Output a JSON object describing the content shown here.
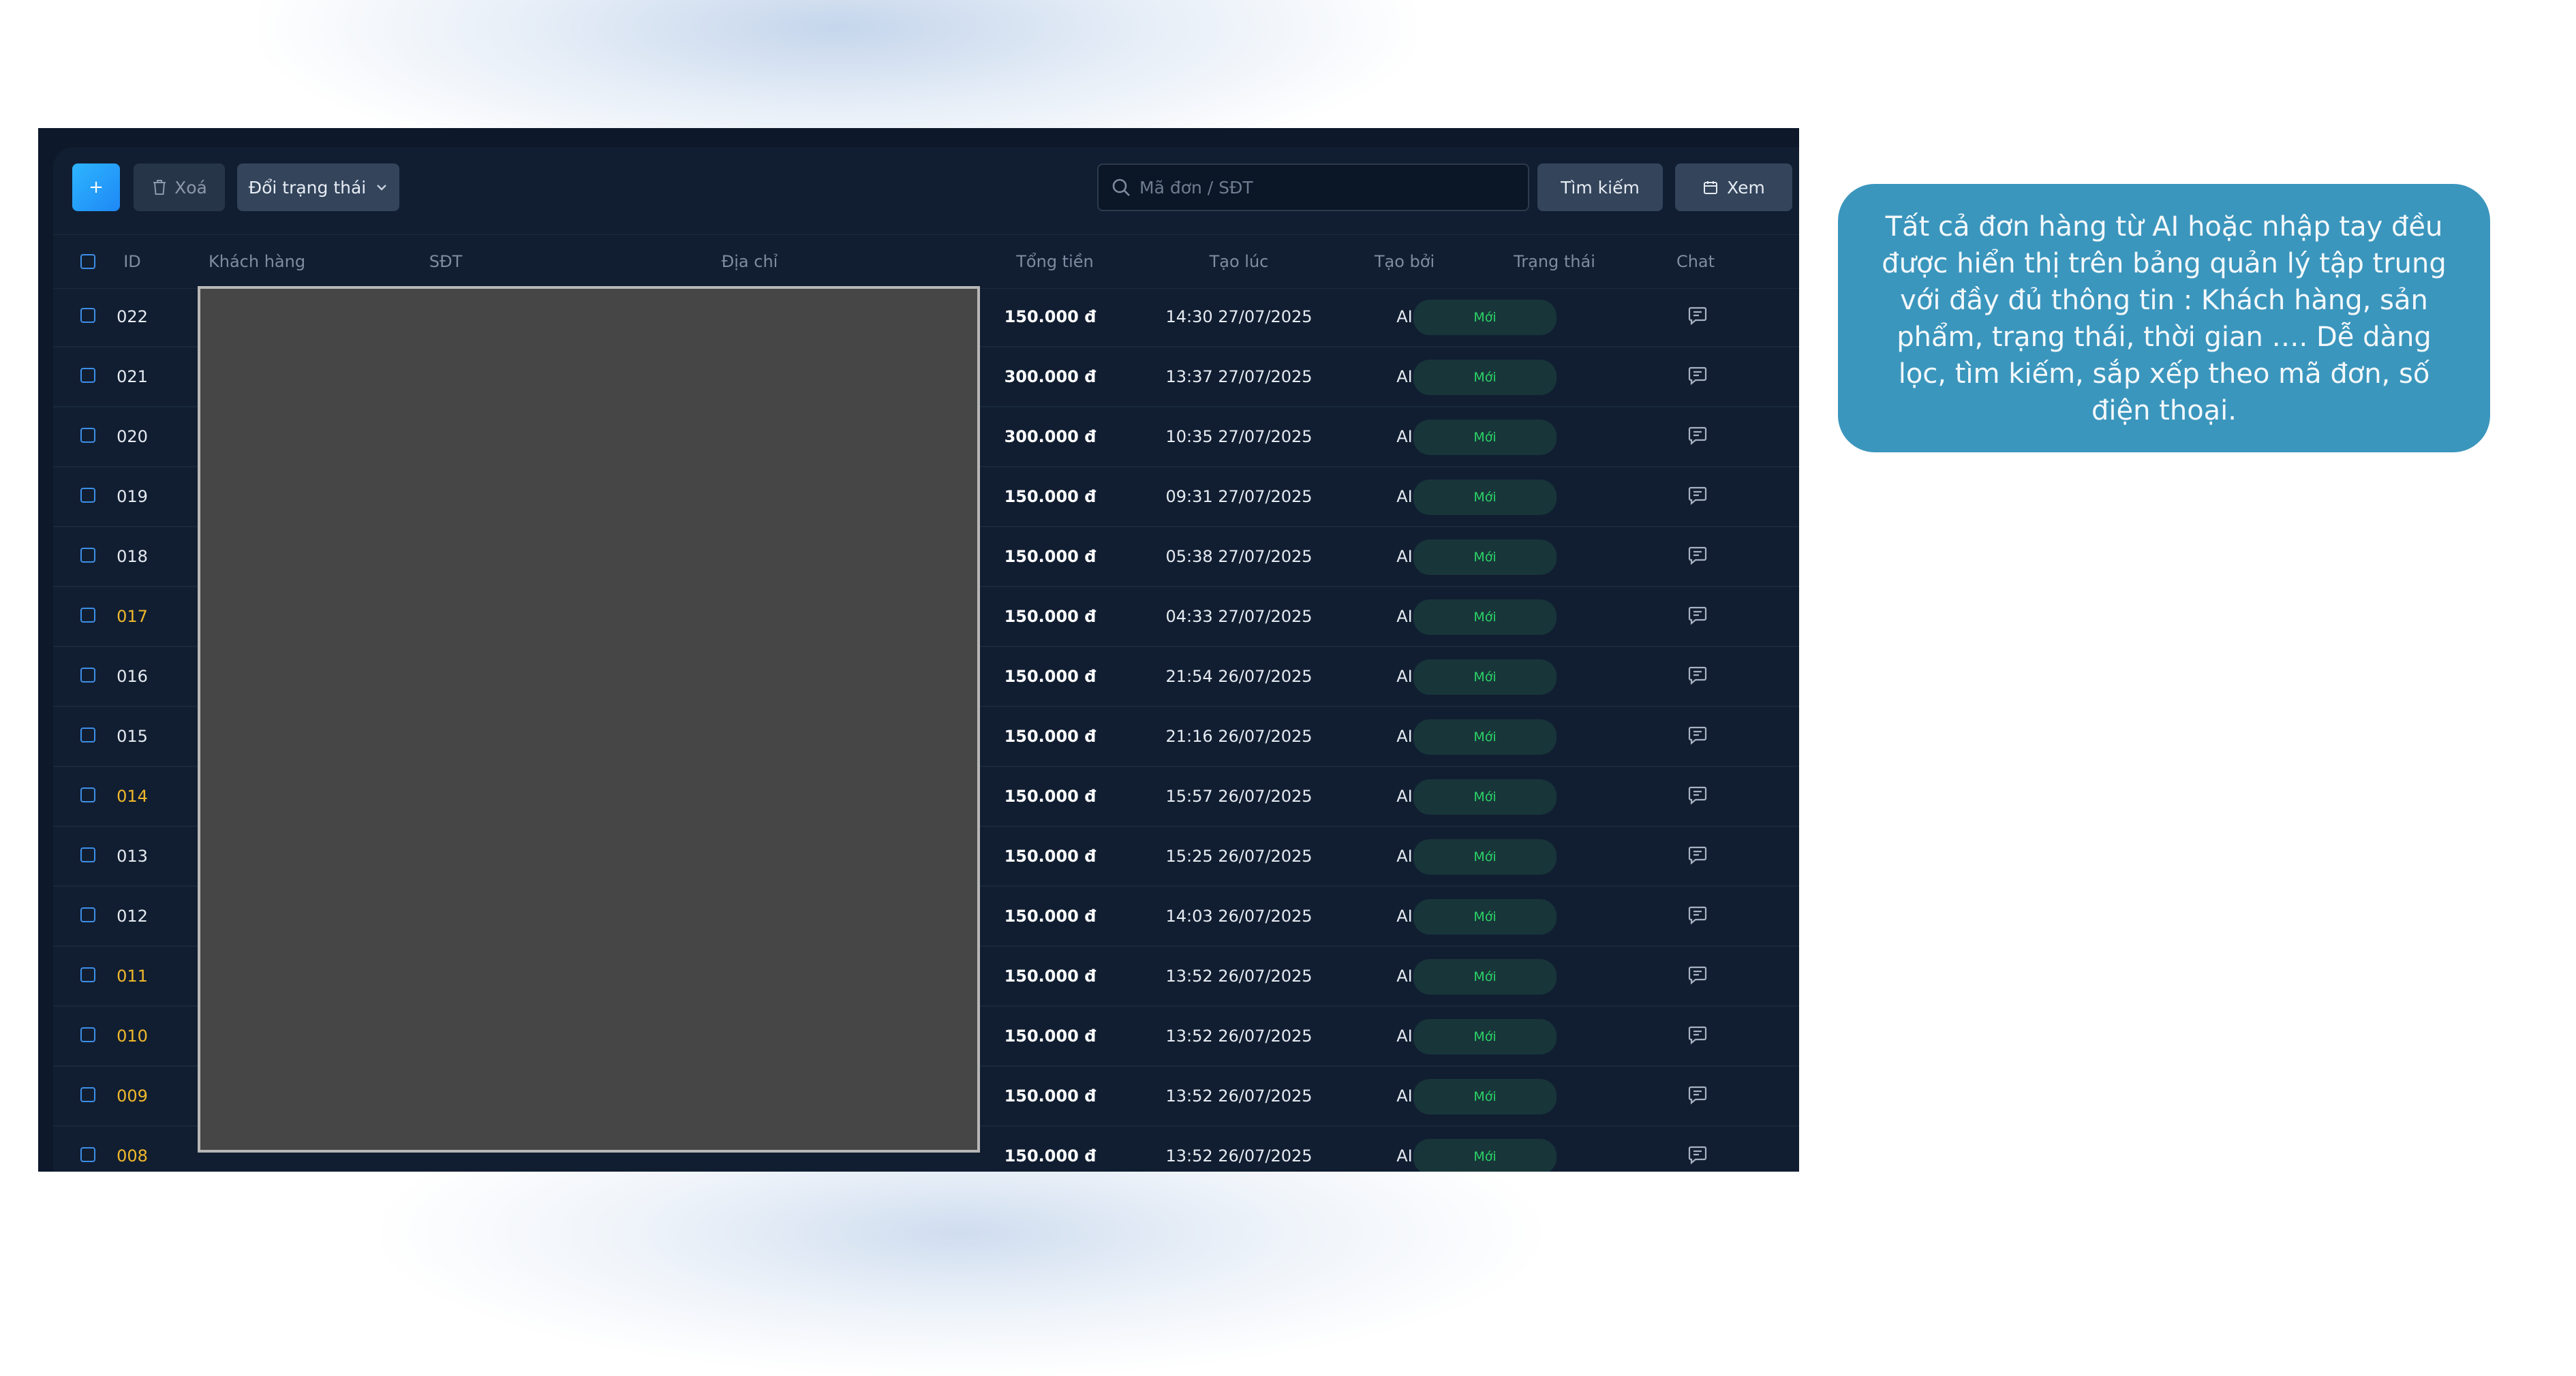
{
  "toolbar": {
    "add_label": "+",
    "delete_label": "Xoá",
    "change_status_label": "Đổi trạng thái",
    "search_placeholder": "Mã đơn / SĐT",
    "search_button_label": "Tìm kiếm",
    "view_button_label": "Xem"
  },
  "table": {
    "columns": {
      "id": "ID",
      "customer": "Khách hàng",
      "phone": "SĐT",
      "address": "Địa chỉ",
      "total": "Tổng tiền",
      "created_at": "Tạo lúc",
      "created_by": "Tạo bởi",
      "status": "Trạng thái",
      "chat": "Chat"
    },
    "rows": [
      {
        "id": "022",
        "total": "150.000 đ",
        "created_at": "14:30 27/07/2025",
        "created_by": "AI",
        "status": "Mới",
        "highlight": false
      },
      {
        "id": "021",
        "total": "300.000 đ",
        "created_at": "13:37 27/07/2025",
        "created_by": "AI",
        "status": "Mới",
        "highlight": false
      },
      {
        "id": "020",
        "total": "300.000 đ",
        "created_at": "10:35 27/07/2025",
        "created_by": "AI",
        "status": "Mới",
        "highlight": false
      },
      {
        "id": "019",
        "total": "150.000 đ",
        "created_at": "09:31 27/07/2025",
        "created_by": "AI",
        "status": "Mới",
        "highlight": false
      },
      {
        "id": "018",
        "total": "150.000 đ",
        "created_at": "05:38 27/07/2025",
        "created_by": "AI",
        "status": "Mới",
        "highlight": false
      },
      {
        "id": "017",
        "total": "150.000 đ",
        "created_at": "04:33 27/07/2025",
        "created_by": "AI",
        "status": "Mới",
        "highlight": true
      },
      {
        "id": "016",
        "total": "150.000 đ",
        "created_at": "21:54 26/07/2025",
        "created_by": "AI",
        "status": "Mới",
        "highlight": false
      },
      {
        "id": "015",
        "total": "150.000 đ",
        "created_at": "21:16 26/07/2025",
        "created_by": "AI",
        "status": "Mới",
        "highlight": false
      },
      {
        "id": "014",
        "total": "150.000 đ",
        "created_at": "15:57 26/07/2025",
        "created_by": "AI",
        "status": "Mới",
        "highlight": true
      },
      {
        "id": "013",
        "total": "150.000 đ",
        "created_at": "15:25 26/07/2025",
        "created_by": "AI",
        "status": "Mới",
        "highlight": false
      },
      {
        "id": "012",
        "total": "150.000 đ",
        "created_at": "14:03 26/07/2025",
        "created_by": "AI",
        "status": "Mới",
        "highlight": false
      },
      {
        "id": "011",
        "total": "150.000 đ",
        "created_at": "13:52 26/07/2025",
        "created_by": "AI",
        "status": "Mới",
        "highlight": true
      },
      {
        "id": "010",
        "total": "150.000 đ",
        "created_at": "13:52 26/07/2025",
        "created_by": "AI",
        "status": "Mới",
        "highlight": true
      },
      {
        "id": "009",
        "total": "150.000 đ",
        "created_at": "13:52 26/07/2025",
        "created_by": "AI",
        "status": "Mới",
        "highlight": true
      },
      {
        "id": "008",
        "total": "150.000 đ",
        "created_at": "13:52 26/07/2025",
        "created_by": "AI",
        "status": "Mới",
        "highlight": true
      }
    ]
  },
  "callout": {
    "text": "Tất cả đơn hàng từ AI hoặc nhập tay đều được hiển thị trên bảng quản lý tập trung với đầy đủ thông tin : Khách hàng, sản phẩm, trạng thái, thời gian …. Dễ dàng lọc, tìm kiếm, sắp xếp theo mã đơn, số điện thoại."
  },
  "colors": {
    "panel_bg": "#0d192b",
    "highlight_id": "#f0b92b",
    "status_text": "#2bd466",
    "callout_bg": "#3b96bd",
    "accent": "#1e88f5"
  },
  "icons": [
    "trash-icon",
    "chevron-down-icon",
    "search-icon",
    "calendar-icon",
    "chat-icon"
  ]
}
